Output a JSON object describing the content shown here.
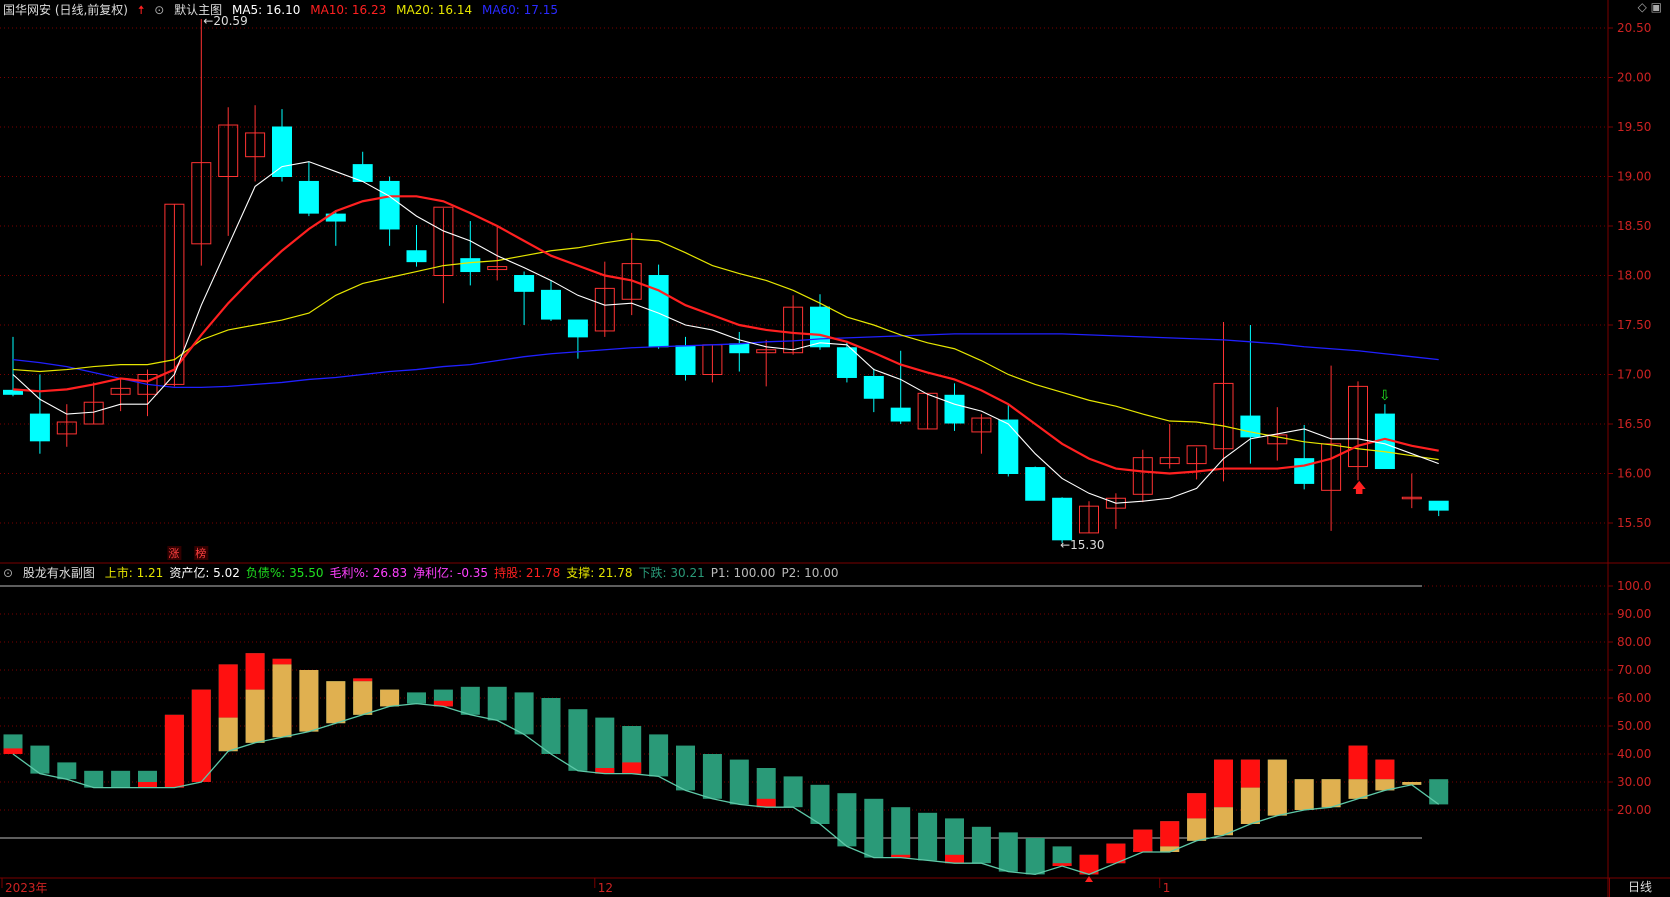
{
  "header": {
    "stock": "国华网安 (日线,前复权)",
    "layout": "默认主图",
    "ma5": "MA5: 16.10",
    "ma10": "MA10: 16.23",
    "ma20": "MA20: 16.14",
    "ma60": "MA60: 17.15",
    "corner_icons": [
      "diamond-icon",
      "square-icon"
    ]
  },
  "colors": {
    "up": "#ff3333",
    "down": "#00ffff",
    "ma5": "#ffffff",
    "ma10": "#ff2020",
    "ma20": "#e6e600",
    "ma60": "#2020ff",
    "grid": "#7a0000",
    "axis_text": "#cc2222",
    "bar_teal": "#2a9a78",
    "bar_red": "#ff1010",
    "bar_gold": "#e0b050",
    "zone_line": "#5ec9a8"
  },
  "sub_header": {
    "title": "股龙有水副图",
    "items": [
      {
        "label": "上市",
        "value": "1.21",
        "color": "#e6e600"
      },
      {
        "label": "资产亿",
        "value": "5.02",
        "color": "#ffffff"
      },
      {
        "label": "负债%",
        "value": "35.50",
        "color": "#20e020"
      },
      {
        "label": "毛利%",
        "value": "26.83",
        "color": "#ff40ff"
      },
      {
        "label": "净利亿",
        "value": "-0.35",
        "color": "#ff40ff"
      },
      {
        "label": "持股",
        "value": "21.78",
        "color": "#ff2020"
      },
      {
        "label": "支撑",
        "value": "21.78",
        "color": "#e6e600"
      },
      {
        "label": "下跌",
        "value": "30.21",
        "color": "#2a9a78"
      },
      {
        "label": "P1",
        "value": "100.00",
        "color": "#bbbbbb"
      },
      {
        "label": "P2",
        "value": "10.00",
        "color": "#bbbbbb"
      }
    ]
  },
  "axis_labels": {
    "main_ticks": [
      "20.50",
      "20.00",
      "19.50",
      "19.00",
      "18.50",
      "18.00",
      "17.50",
      "17.00",
      "16.50",
      "16.00",
      "15.50"
    ],
    "sub_ticks": [
      "100.0",
      "90.00",
      "80.00",
      "70.00",
      "60.00",
      "50.00",
      "40.00",
      "30.00",
      "20.00"
    ],
    "dates": [
      {
        "text": "2023年",
        "index": 0
      },
      {
        "text": "12",
        "index": 22
      },
      {
        "text": "1",
        "index": 43
      }
    ],
    "period": "日线"
  },
  "markers": {
    "high_label": "20.59",
    "low_label": "15.30",
    "badge_1": "涨",
    "badge_2": "榜"
  },
  "chart_data": [
    {
      "type": "candlestick",
      "title": "国华网安 (日线,前复权)",
      "y_range": [
        15.2,
        20.6
      ],
      "candles": [
        {
          "o": 16.84,
          "h": 17.38,
          "l": 16.78,
          "c": 16.8
        },
        {
          "o": 16.6,
          "h": 17.0,
          "l": 16.2,
          "c": 16.33
        },
        {
          "o": 16.4,
          "h": 16.7,
          "l": 16.27,
          "c": 16.52
        },
        {
          "o": 16.5,
          "h": 16.92,
          "l": 16.5,
          "c": 16.72
        },
        {
          "o": 16.8,
          "h": 16.97,
          "l": 16.63,
          "c": 16.86
        },
        {
          "o": 16.8,
          "h": 17.05,
          "l": 16.58,
          "c": 17.0
        },
        {
          "o": 16.9,
          "h": 18.72,
          "l": 16.88,
          "c": 18.72
        },
        {
          "o": 18.32,
          "h": 20.59,
          "l": 18.1,
          "c": 19.14
        },
        {
          "o": 19.0,
          "h": 19.7,
          "l": 18.4,
          "c": 19.52
        },
        {
          "o": 19.2,
          "h": 19.72,
          "l": 18.95,
          "c": 19.44
        },
        {
          "o": 19.5,
          "h": 19.68,
          "l": 18.95,
          "c": 19.0
        },
        {
          "o": 18.95,
          "h": 19.15,
          "l": 18.6,
          "c": 18.63
        },
        {
          "o": 18.62,
          "h": 18.66,
          "l": 18.3,
          "c": 18.55
        },
        {
          "o": 19.12,
          "h": 19.25,
          "l": 18.95,
          "c": 18.95
        },
        {
          "o": 18.95,
          "h": 19.0,
          "l": 18.3,
          "c": 18.47
        },
        {
          "o": 18.25,
          "h": 18.51,
          "l": 18.09,
          "c": 18.14
        },
        {
          "o": 18.0,
          "h": 18.68,
          "l": 17.72,
          "c": 18.69
        },
        {
          "o": 18.17,
          "h": 18.55,
          "l": 17.9,
          "c": 18.04
        },
        {
          "o": 18.06,
          "h": 18.51,
          "l": 17.95,
          "c": 18.09
        },
        {
          "o": 18.0,
          "h": 18.04,
          "l": 17.5,
          "c": 17.84
        },
        {
          "o": 17.85,
          "h": 17.95,
          "l": 17.54,
          "c": 17.56
        },
        {
          "o": 17.55,
          "h": 17.55,
          "l": 17.16,
          "c": 17.38
        },
        {
          "o": 17.44,
          "h": 18.14,
          "l": 17.38,
          "c": 17.87
        },
        {
          "o": 17.76,
          "h": 18.43,
          "l": 17.6,
          "c": 18.12
        },
        {
          "o": 18.0,
          "h": 18.11,
          "l": 17.26,
          "c": 17.28
        },
        {
          "o": 17.29,
          "h": 17.38,
          "l": 16.94,
          "c": 17.0
        },
        {
          "o": 17.0,
          "h": 17.3,
          "l": 16.92,
          "c": 17.3
        },
        {
          "o": 17.31,
          "h": 17.43,
          "l": 17.03,
          "c": 17.22
        },
        {
          "o": 17.22,
          "h": 17.35,
          "l": 16.88,
          "c": 17.25
        },
        {
          "o": 17.22,
          "h": 17.8,
          "l": 17.2,
          "c": 17.68
        },
        {
          "o": 17.68,
          "h": 17.81,
          "l": 17.25,
          "c": 17.28
        },
        {
          "o": 17.27,
          "h": 17.34,
          "l": 16.92,
          "c": 16.97
        },
        {
          "o": 16.98,
          "h": 17.06,
          "l": 16.62,
          "c": 16.76
        },
        {
          "o": 16.66,
          "h": 17.24,
          "l": 16.5,
          "c": 16.53
        },
        {
          "o": 16.45,
          "h": 16.81,
          "l": 16.45,
          "c": 16.81
        },
        {
          "o": 16.79,
          "h": 16.91,
          "l": 16.43,
          "c": 16.51
        },
        {
          "o": 16.42,
          "h": 16.6,
          "l": 16.2,
          "c": 16.56
        },
        {
          "o": 16.54,
          "h": 16.7,
          "l": 15.97,
          "c": 16.0
        },
        {
          "o": 16.06,
          "h": 16.07,
          "l": 15.73,
          "c": 15.73
        },
        {
          "o": 15.75,
          "h": 15.76,
          "l": 15.3,
          "c": 15.33
        },
        {
          "o": 15.4,
          "h": 15.72,
          "l": 15.4,
          "c": 15.67
        },
        {
          "o": 15.65,
          "h": 15.8,
          "l": 15.44,
          "c": 15.75
        },
        {
          "o": 15.79,
          "h": 16.24,
          "l": 15.71,
          "c": 16.16
        },
        {
          "o": 16.1,
          "h": 16.5,
          "l": 16.05,
          "c": 16.16
        },
        {
          "o": 16.1,
          "h": 16.26,
          "l": 15.94,
          "c": 16.28
        },
        {
          "o": 16.25,
          "h": 17.53,
          "l": 15.92,
          "c": 16.91
        },
        {
          "o": 16.58,
          "h": 17.5,
          "l": 16.1,
          "c": 16.37
        },
        {
          "o": 16.3,
          "h": 16.67,
          "l": 16.13,
          "c": 16.39
        },
        {
          "o": 16.15,
          "h": 16.49,
          "l": 15.84,
          "c": 15.9
        },
        {
          "o": 15.83,
          "h": 17.09,
          "l": 15.42,
          "c": 16.3
        },
        {
          "o": 16.07,
          "h": 16.93,
          "l": 15.93,
          "c": 16.88
        },
        {
          "o": 16.6,
          "h": 16.7,
          "l": 16.05,
          "c": 16.05
        },
        {
          "o": 15.76,
          "h": 16.0,
          "l": 15.65,
          "c": 15.76
        },
        {
          "o": 15.72,
          "h": 15.72,
          "l": 15.57,
          "c": 15.63
        }
      ],
      "ma5": [
        17.0,
        16.75,
        16.6,
        16.62,
        16.7,
        16.7,
        17.0,
        17.7,
        18.3,
        18.9,
        19.1,
        19.15,
        19.05,
        18.95,
        18.8,
        18.6,
        18.45,
        18.35,
        18.2,
        18.08,
        17.95,
        17.8,
        17.7,
        17.72,
        17.62,
        17.5,
        17.45,
        17.35,
        17.28,
        17.25,
        17.32,
        17.3,
        17.05,
        16.95,
        16.8,
        16.7,
        16.63,
        16.5,
        16.2,
        15.95,
        15.8,
        15.7,
        15.72,
        15.75,
        15.85,
        16.15,
        16.35,
        16.4,
        16.45,
        16.35,
        16.35,
        16.3,
        16.2,
        16.1
      ],
      "ma10": [
        16.85,
        16.83,
        16.85,
        16.9,
        16.96,
        16.93,
        17.05,
        17.4,
        17.72,
        18.0,
        18.25,
        18.47,
        18.65,
        18.75,
        18.8,
        18.8,
        18.75,
        18.63,
        18.5,
        18.35,
        18.2,
        18.1,
        18.0,
        17.95,
        17.85,
        17.7,
        17.6,
        17.5,
        17.45,
        17.42,
        17.4,
        17.33,
        17.22,
        17.1,
        17.02,
        16.95,
        16.84,
        16.7,
        16.5,
        16.3,
        16.15,
        16.05,
        16.02,
        16.0,
        16.02,
        16.05,
        16.05,
        16.05,
        16.08,
        16.15,
        16.28,
        16.35,
        16.28,
        16.23
      ],
      "ma20": [
        17.05,
        17.03,
        17.05,
        17.08,
        17.1,
        17.1,
        17.15,
        17.35,
        17.45,
        17.5,
        17.55,
        17.62,
        17.8,
        17.92,
        17.98,
        18.04,
        18.1,
        18.13,
        18.15,
        18.2,
        18.25,
        18.28,
        18.33,
        18.37,
        18.35,
        18.23,
        18.1,
        18.02,
        17.95,
        17.85,
        17.72,
        17.58,
        17.5,
        17.4,
        17.32,
        17.26,
        17.14,
        17.0,
        16.9,
        16.82,
        16.74,
        16.68,
        16.6,
        16.53,
        16.52,
        16.48,
        16.42,
        16.37,
        16.32,
        16.29,
        16.25,
        16.22,
        16.18,
        16.14
      ],
      "ma60": [
        17.15,
        17.12,
        17.08,
        17.02,
        16.96,
        16.9,
        16.87,
        16.87,
        16.88,
        16.9,
        16.92,
        16.95,
        16.97,
        17.0,
        17.03,
        17.05,
        17.08,
        17.1,
        17.14,
        17.18,
        17.21,
        17.23,
        17.25,
        17.27,
        17.28,
        17.29,
        17.3,
        17.31,
        17.33,
        17.34,
        17.36,
        17.37,
        17.38,
        17.39,
        17.4,
        17.41,
        17.41,
        17.41,
        17.41,
        17.41,
        17.4,
        17.39,
        17.38,
        17.37,
        17.36,
        17.35,
        17.33,
        17.31,
        17.28,
        17.26,
        17.24,
        17.21,
        17.18,
        17.15
      ]
    },
    {
      "type": "bar",
      "title": "股龙有水副图",
      "y_range": [
        0,
        105
      ],
      "reference_lines": [
        100,
        10
      ],
      "bars": [
        {
          "top": 47,
          "bot": 40,
          "red": [
            40,
            42
          ]
        },
        {
          "top": 43,
          "bot": 33,
          "red": null
        },
        {
          "top": 37,
          "bot": 31,
          "red": null
        },
        {
          "top": 34,
          "bot": 28,
          "red": null
        },
        {
          "top": 34,
          "bot": 28,
          "red": null
        },
        {
          "top": 34,
          "bot": 28,
          "red": [
            28,
            30
          ]
        },
        {
          "top": 54,
          "bot": 28,
          "red": [
            28,
            54
          ]
        },
        {
          "top": 63,
          "bot": 30,
          "red": [
            30,
            63
          ]
        },
        {
          "top": 72,
          "bot": 41,
          "red": [
            53,
            72
          ],
          "gold": [
            41,
            53
          ]
        },
        {
          "top": 76,
          "bot": 44,
          "red": [
            63,
            76
          ],
          "gold": [
            44,
            63
          ]
        },
        {
          "top": 74,
          "bot": 46,
          "red": [
            72,
            74
          ],
          "gold": [
            46,
            72
          ]
        },
        {
          "top": 70,
          "bot": 48,
          "gold": [
            48,
            70
          ]
        },
        {
          "top": 66,
          "bot": 51,
          "gold": [
            51,
            66
          ]
        },
        {
          "top": 67,
          "bot": 54,
          "red": [
            66,
            67
          ],
          "gold": [
            54,
            66
          ]
        },
        {
          "top": 63,
          "bot": 57,
          "gold": [
            57,
            63
          ]
        },
        {
          "top": 62,
          "bot": 58,
          "red": null
        },
        {
          "top": 63,
          "bot": 57,
          "red": [
            57,
            59
          ]
        },
        {
          "top": 64,
          "bot": 54,
          "red": null
        },
        {
          "top": 64,
          "bot": 52,
          "red": null
        },
        {
          "top": 62,
          "bot": 47,
          "red": null
        },
        {
          "top": 60,
          "bot": 40,
          "red": null
        },
        {
          "top": 56,
          "bot": 34,
          "red": null
        },
        {
          "top": 53,
          "bot": 33,
          "red": [
            33,
            35
          ]
        },
        {
          "top": 50,
          "bot": 33,
          "red": [
            33,
            37
          ]
        },
        {
          "top": 47,
          "bot": 32,
          "red": null
        },
        {
          "top": 43,
          "bot": 27,
          "red": null
        },
        {
          "top": 40,
          "bot": 24,
          "red": null
        },
        {
          "top": 38,
          "bot": 22,
          "red": null
        },
        {
          "top": 35,
          "bot": 21,
          "red": [
            21,
            24
          ]
        },
        {
          "top": 32,
          "bot": 21,
          "red": null
        },
        {
          "top": 29,
          "bot": 15,
          "red": null
        },
        {
          "top": 26,
          "bot": 7,
          "red": null
        },
        {
          "top": 24,
          "bot": 3,
          "red": null
        },
        {
          "top": 21,
          "bot": 3,
          "red": [
            3,
            4
          ]
        },
        {
          "top": 19,
          "bot": 2,
          "red": null
        },
        {
          "top": 17,
          "bot": 1,
          "red": [
            1,
            4
          ]
        },
        {
          "top": 14,
          "bot": 1,
          "red": null
        },
        {
          "top": 12,
          "bot": -2,
          "red": null
        },
        {
          "top": 10,
          "bot": -3,
          "red": null
        },
        {
          "top": 7,
          "bot": 0,
          "red": [
            0,
            1
          ]
        },
        {
          "top": 4,
          "bot": -3,
          "red": [
            -3,
            4
          ]
        },
        {
          "top": 8,
          "bot": 1,
          "red": [
            1,
            8
          ]
        },
        {
          "top": 13,
          "bot": 5,
          "red": [
            5,
            13
          ],
          "gold": [
            5,
            6
          ]
        },
        {
          "top": 16,
          "bot": 5,
          "red": [
            7,
            16
          ],
          "gold": [
            5,
            7
          ]
        },
        {
          "top": 26,
          "bot": 9,
          "red": [
            17,
            26
          ],
          "gold": [
            9,
            17
          ]
        },
        {
          "top": 38,
          "bot": 11,
          "red": [
            21,
            38
          ],
          "gold": [
            11,
            21
          ]
        },
        {
          "top": 38,
          "bot": 15,
          "red": [
            28,
            38
          ],
          "gold": [
            15,
            28
          ]
        },
        {
          "top": 38,
          "bot": 18,
          "gold": [
            18,
            38
          ]
        },
        {
          "top": 31,
          "bot": 20,
          "gold": [
            20,
            31
          ]
        },
        {
          "top": 31,
          "bot": 21,
          "gold": [
            21,
            31
          ]
        },
        {
          "top": 43,
          "bot": 24,
          "red": [
            31,
            43
          ],
          "gold": [
            24,
            31
          ]
        },
        {
          "top": 38,
          "bot": 27,
          "red": [
            31,
            38
          ],
          "gold": [
            27,
            31
          ]
        },
        {
          "top": 30,
          "bot": 29,
          "gold": [
            29,
            30
          ]
        },
        {
          "top": 31,
          "bot": 22,
          "red": null
        }
      ]
    }
  ]
}
